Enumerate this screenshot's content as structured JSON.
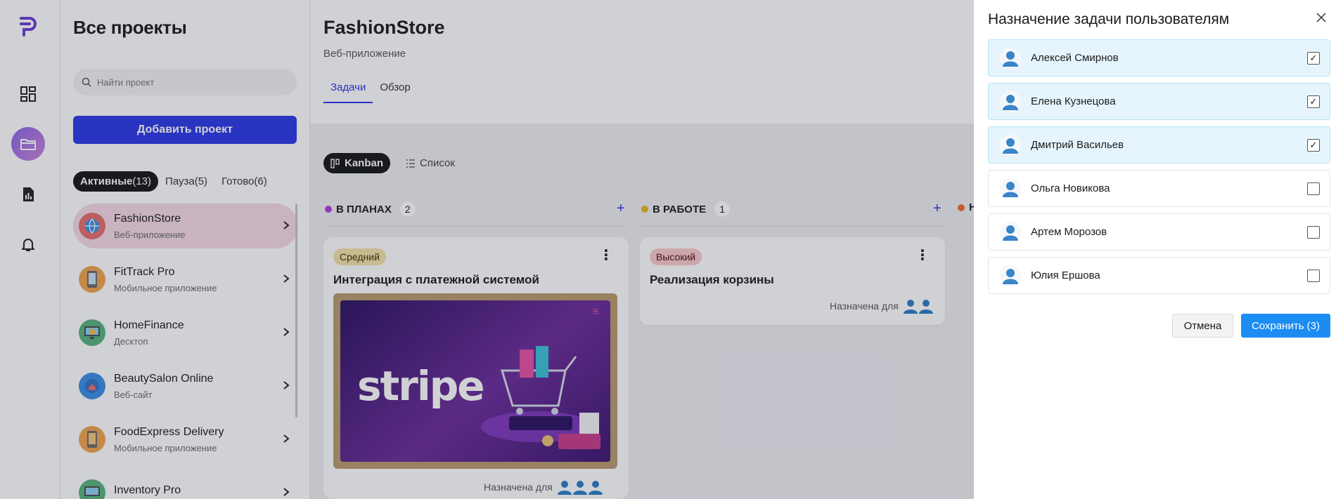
{
  "sidebar": {
    "title": "Все проекты",
    "search_placeholder": "Найти проект",
    "add_button": "Добавить проект",
    "filters": [
      {
        "label": "Активные",
        "count": "(13)"
      },
      {
        "label": "Пауза",
        "count": "(5)"
      },
      {
        "label": "Готово",
        "count": "(6)"
      }
    ],
    "projects": [
      {
        "name": "FashionStore",
        "type": "Веб-приложение",
        "icon": "globe-icon"
      },
      {
        "name": "FitTrack Pro",
        "type": "Мобильное приложение",
        "icon": "phone-icon"
      },
      {
        "name": "HomeFinance",
        "type": "Десктоп",
        "icon": "desktop-icon"
      },
      {
        "name": "BeautySalon Online",
        "type": "Веб-сайт",
        "icon": "globe-icon"
      },
      {
        "name": "FoodExpress Delivery",
        "type": "Мобильное приложение",
        "icon": "phone-icon"
      },
      {
        "name": "Inventory Pro",
        "type": "",
        "icon": "desktop-icon"
      }
    ]
  },
  "project": {
    "title": "FashionStore",
    "subtitle": "Веб-приложение",
    "tabs": [
      "Задачи",
      "Обзор"
    ],
    "views": [
      "Kanban",
      "Список"
    ]
  },
  "columns": [
    {
      "label": "В ПЛАНАХ",
      "count": "2",
      "color": "#b23be0"
    },
    {
      "label": "В РАБОТЕ",
      "count": "1",
      "color": "#e6b417"
    },
    {
      "label": "Н",
      "count": "",
      "color": "#ee6a2a"
    }
  ],
  "cards": [
    {
      "priority": "Средний",
      "title": "Интеграция с платежной системой",
      "assigned": "Назначена для",
      "image_text": "stripe"
    },
    {
      "priority": "Высокий",
      "title": "Реализация корзины",
      "assigned": "Назначена для"
    }
  ],
  "modal": {
    "title": "Назначение задачи пользователям",
    "users": [
      {
        "name": "Алексей Смирнов",
        "checked": true
      },
      {
        "name": "Елена Кузнецова",
        "checked": true
      },
      {
        "name": "Дмитрий Васильев",
        "checked": true
      },
      {
        "name": "Ольга Новикова",
        "checked": false
      },
      {
        "name": "Артем Морозов",
        "checked": false
      },
      {
        "name": "Юлия Ершова",
        "checked": false
      }
    ],
    "cancel": "Отмена",
    "save": "Сохранить (3)",
    "check_mark": "✓"
  },
  "colors": {
    "accent": "#2a36e6",
    "save_button": "#1b8cf2",
    "selected_row": "#e6f5fd"
  }
}
